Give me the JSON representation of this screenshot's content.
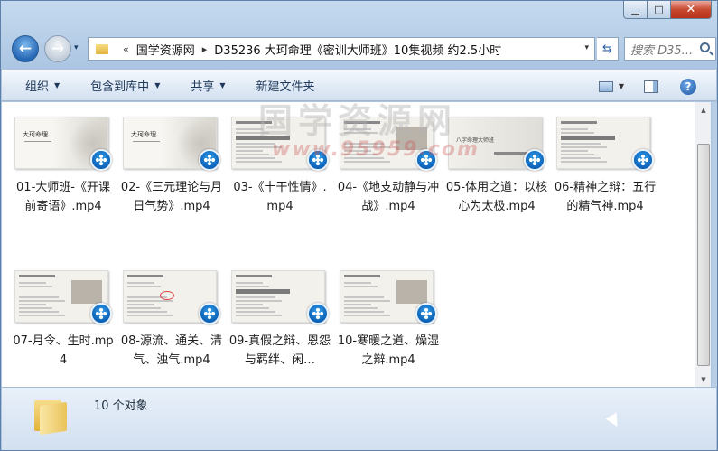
{
  "window": {
    "caption": {
      "minimize": "▁",
      "maximize": "□",
      "close": "✕"
    }
  },
  "nav": {
    "back_icon": "arrow-left-icon",
    "forward_icon": "arrow-right-icon",
    "history_dropdown": "▾",
    "address": {
      "overflow": "«",
      "crumbs": [
        "国学资源网",
        "D35236 大珂命理《密训大师班》10集视频 约2.5小时"
      ],
      "separator": "▸",
      "dropdown": "▾"
    },
    "refresh": "⇆",
    "search_placeholder": "搜索 D35..."
  },
  "toolbar": {
    "organize": "组织",
    "include_library": "包含到库中",
    "share": "共享",
    "new_folder": "新建文件夹",
    "dropdown_arrow": "▼",
    "help": "?"
  },
  "watermark": {
    "text": "国学资源网",
    "url": "www.95959.com"
  },
  "files": [
    {
      "name": "01-大师班-《开课前寄语》.mp4",
      "thumb_style": "title",
      "thumb_text": "大珂命理"
    },
    {
      "name": "02-《三元理论与月日气势》.mp4",
      "thumb_style": "title",
      "thumb_text": "大珂命理"
    },
    {
      "name": "03-《十干性情》.mp4",
      "thumb_style": "doc"
    },
    {
      "name": "04-《地支动静与冲战》.mp4",
      "thumb_style": "doc"
    },
    {
      "name": "05-体用之道：以核心为太极.mp4",
      "thumb_style": "banner",
      "thumb_text": "八字命理大师班"
    },
    {
      "name": "06-精神之辩：五行的精气神.mp4",
      "thumb_style": "doc"
    },
    {
      "name": "07-月令、生时.mp4",
      "thumb_style": "doc"
    },
    {
      "name": "08-源流、通关、清气、浊气.mp4",
      "thumb_style": "doc"
    },
    {
      "name": "09-真假之辩、恩怨与羁绊、闲…",
      "thumb_style": "doc"
    },
    {
      "name": "10-寒暖之道、燥湿之辩.mp4",
      "thumb_style": "doc"
    }
  ],
  "status": {
    "count": "10 个对象"
  },
  "colors": {
    "accent": "#2566b4",
    "badge": "#0b5fb5"
  }
}
